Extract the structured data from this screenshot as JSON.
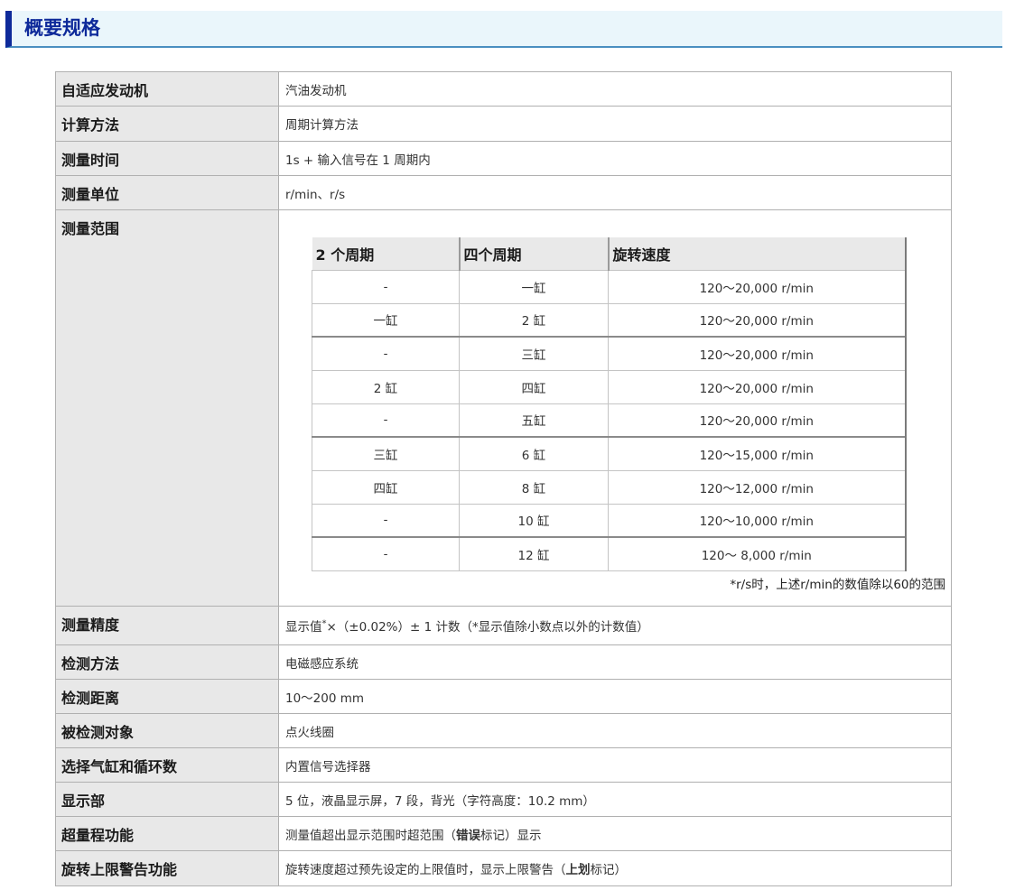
{
  "page_title": "概要规格",
  "specs": [
    {
      "label": "自适应发动机",
      "value": "汽油发动机"
    },
    {
      "label": "计算方法",
      "value": "周期计算方法"
    },
    {
      "label": "测量时间",
      "value": "1s + 输入信号在 1 周期内"
    },
    {
      "label": "测量单位",
      "value": "r/min、r/s"
    },
    {
      "label": "测量范围"
    },
    {
      "label": "测量精度",
      "value_pre": "显示值",
      "value_sup": "*",
      "value_post": "×（±0.02%）± 1 计数（*显示值除小数点以外的计数值）"
    },
    {
      "label": "检测方法",
      "value": "电磁感应系统"
    },
    {
      "label": "检测距离",
      "value": "10～200 mm"
    },
    {
      "label": "被检测对象",
      "value": "点火线圈"
    },
    {
      "label": "选择气缸和循环数",
      "value": "内置信号选择器"
    },
    {
      "label": "显示部",
      "value": "5 位，液晶显示屏，7 段，背光（字符高度：10.2 mm）"
    },
    {
      "label": "超量程功能",
      "value_pre": "测量值超出显示范围时超范围（",
      "value_bold": "错误",
      "value_post": "标记）显示"
    },
    {
      "label": "旋转上限警告功能",
      "value_pre": "旋转速度超过预先设定的上限值时，显示上限警告（",
      "value_bold": "上划",
      "value_post": "标记）"
    }
  ],
  "range_table": {
    "headers": [
      "2 个周期",
      "四个周期",
      "旋转速度"
    ],
    "rows": [
      [
        "-",
        "一缸",
        "120～20,000 r/min"
      ],
      [
        "一缸",
        "2 缸",
        "120～20,000 r/min"
      ],
      [
        "-",
        "三缸",
        "120～20,000 r/min"
      ],
      [
        "2 缸",
        "四缸",
        "120～20,000 r/min"
      ],
      [
        "-",
        "五缸",
        "120～20,000 r/min"
      ],
      [
        "三缸",
        "6 缸",
        "120～15,000 r/min"
      ],
      [
        "四缸",
        "8 缸",
        "120～12,000 r/min"
      ],
      [
        "-",
        "10 缸",
        "120～10,000 r/min"
      ],
      [
        "-",
        "12 缸",
        "120～ 8,000 r/min"
      ]
    ],
    "note": "*r/s时，上述r/min的数值除以60的范围"
  }
}
